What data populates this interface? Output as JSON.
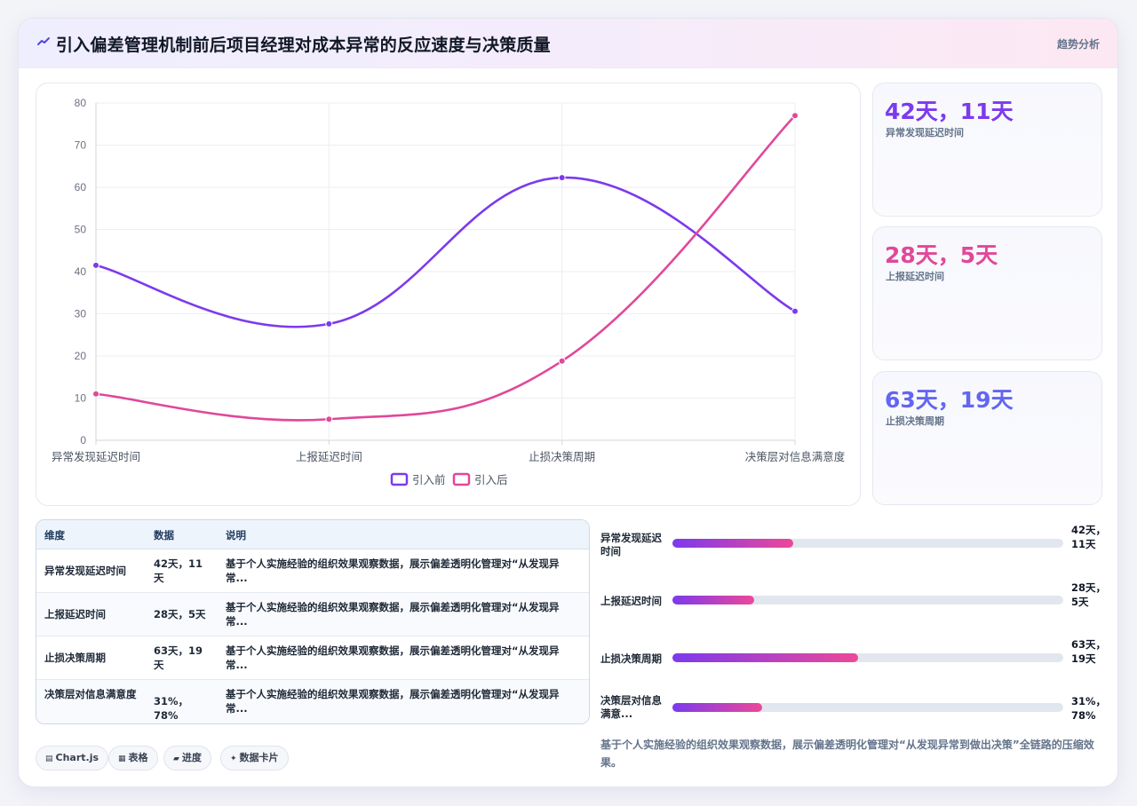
{
  "header": {
    "title": "引入偏差管理机制前后项目经理对成本异常的反应速度与决策质量",
    "tag": "趋势分析"
  },
  "chart_data": {
    "type": "line",
    "categories": [
      "异常发现延迟时间",
      "上报延迟时间",
      "止损决策周期",
      "决策层对信息满意度"
    ],
    "series": [
      {
        "name": "引入前",
        "values": [
          41.5,
          27.6,
          62.3,
          30.6
        ],
        "color": "#7c3aed"
      },
      {
        "name": "引入后",
        "values": [
          11,
          5,
          18.8,
          77
        ],
        "color": "#e0489a"
      }
    ],
    "ylim": [
      0,
      80
    ],
    "yticks": [
      0,
      10,
      20,
      30,
      40,
      50,
      60,
      70,
      80
    ],
    "grid": true,
    "legend": "bottom"
  },
  "stats": [
    {
      "value": "42天，11天",
      "label": "异常发现延迟时间",
      "color": "#7c3aed"
    },
    {
      "value": "28天，5天",
      "label": "上报延迟时间",
      "color": "#e0489a"
    },
    {
      "value": "63天，19天",
      "label": "止损决策周期",
      "color": "#6366f1"
    }
  ],
  "table": {
    "headers": [
      "维度",
      "数据",
      "说明"
    ],
    "rows": [
      {
        "dim": "异常发现延迟时间",
        "data": "42天，11天",
        "desc": "基于个人实施经验的组织效果观察数据，展示偏差透明化管理对“从发现异常..."
      },
      {
        "dim": "上报延迟时间",
        "data": "28天，5天",
        "desc": "基于个人实施经验的组织效果观察数据，展示偏差透明化管理对“从发现异常..."
      },
      {
        "dim": "止损决策周期",
        "data": "63天，19天",
        "desc": "基于个人实施经验的组织效果观察数据，展示偏差透明化管理对“从发现异常..."
      },
      {
        "dim": "决策层对信息满意度",
        "data": "31%，78%",
        "desc": "基于个人实施经验的组织效果观察数据，展示偏差透明化管理对“从发现异常..."
      }
    ]
  },
  "progress": [
    {
      "label": "异常发现延迟时间",
      "value": "42天，11天",
      "fraction": 0.31
    },
    {
      "label": "上报延迟时间",
      "value": "28天，5天",
      "fraction": 0.21
    },
    {
      "label": "止损决策周期",
      "value": "63天，19天",
      "fraction": 0.475
    },
    {
      "label": "决策层对信息满意...",
      "value": "31%，78%",
      "fraction": 0.23
    }
  ],
  "footnote": "基于个人实施经验的组织效果观察数据，展示偏差透明化管理对“从发现异常到做出决策”全链路的压缩效果。",
  "chips": [
    {
      "icon": "▤",
      "label": "Chart.js",
      "icon_name": "chart-icon"
    },
    {
      "icon": "▦",
      "label": "表格",
      "icon_name": "table-icon"
    },
    {
      "icon": "▰",
      "label": "进度",
      "icon_name": "progress-icon"
    },
    {
      "icon": "✦",
      "label": "数据卡片",
      "icon_name": "sparkle-icon"
    }
  ]
}
